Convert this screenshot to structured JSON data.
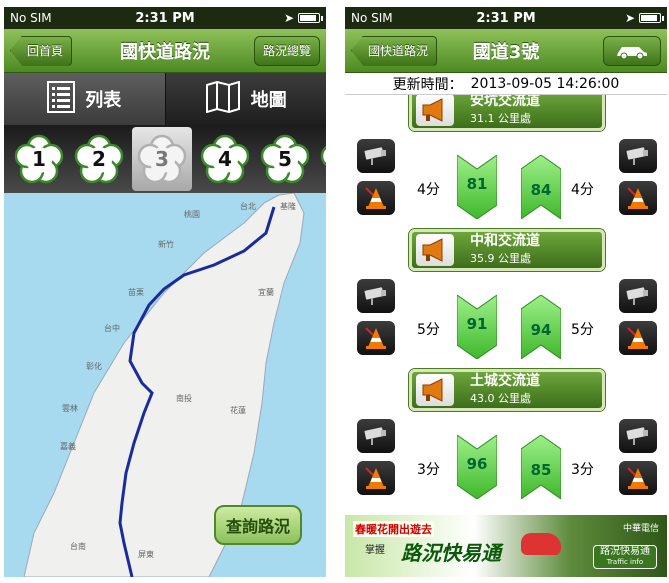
{
  "left": {
    "status": {
      "carrier": "No SIM",
      "time": "2:31 PM"
    },
    "nav": {
      "back": "回首頁",
      "title": "國快道路況",
      "right": "路況總覽"
    },
    "segments": [
      {
        "label": "列表"
      },
      {
        "label": "地圖"
      }
    ],
    "routes": [
      "1",
      "2",
      "3",
      "4",
      "5"
    ],
    "selected_route": "3",
    "map_cities": [
      "台北",
      "基隆",
      "桃園",
      "新竹",
      "苗栗",
      "宜蘭",
      "台中",
      "彰化",
      "南投",
      "花蓮",
      "雲林",
      "嘉義",
      "台南",
      "屏東"
    ],
    "query_button": "查詢路況"
  },
  "right": {
    "status": {
      "carrier": "No SIM",
      "time": "2:31 PM"
    },
    "nav": {
      "back": "國快道路況",
      "title": "國道3號"
    },
    "update": {
      "label": "更新時間：",
      "value": "2013-09-05 14:26:00"
    },
    "interchanges": [
      {
        "name": "安坑交流道",
        "km": "31.1 公里處",
        "left_time": "4分",
        "left_speed": "81",
        "right_speed": "84",
        "right_time": "4分"
      },
      {
        "name": "中和交流道",
        "km": "35.9 公里處",
        "left_time": "5分",
        "left_speed": "91",
        "right_speed": "94",
        "right_time": "5分"
      },
      {
        "name": "土城交流道",
        "km": "43.0 公里處",
        "left_time": "3分",
        "left_speed": "96",
        "right_speed": "85",
        "right_time": "3分"
      }
    ],
    "banner": {
      "line1": "春暖花開出遊去",
      "line2": "掌握",
      "line3": "路況快易通",
      "brand": "中華電信",
      "app": "路況快易通",
      "app_sub": "Traffic info"
    }
  },
  "colors": {
    "nav_green": "#4d8a22",
    "route_line": "#1a2c9c",
    "speed_green": "#5fcf3c"
  }
}
